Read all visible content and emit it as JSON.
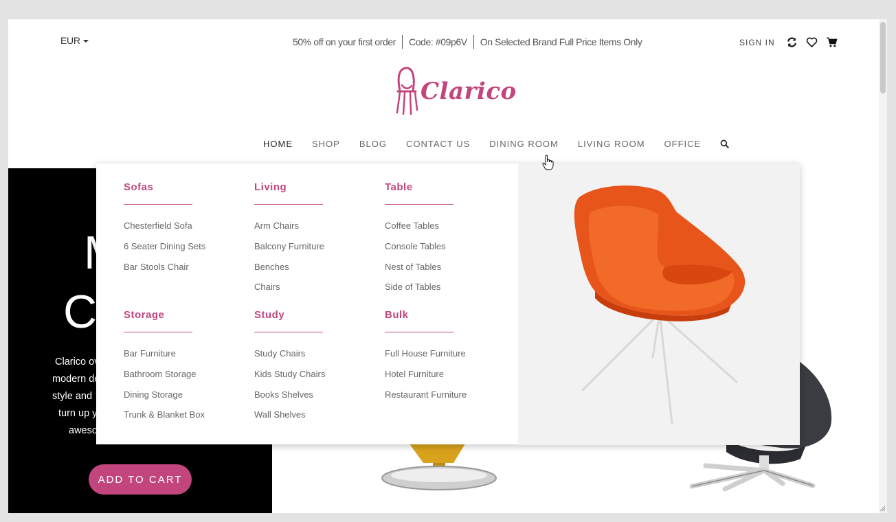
{
  "header": {
    "currency": "EUR",
    "promo": [
      "50% off on your first order",
      "Code: #09p6V",
      "On Selected Brand Full Price Items Only"
    ],
    "signin": "SIGN IN"
  },
  "logo": {
    "text": "Clarico"
  },
  "nav": {
    "items": [
      "HOME",
      "SHOP",
      "BLOG",
      "CONTACT US",
      "DINING ROOM",
      "LIVING ROOM",
      "OFFICE"
    ],
    "active": "HOME",
    "hovered": "LIVING ROOM"
  },
  "hero": {
    "heading_line1": "M",
    "heading_line2": "Co",
    "desc_lines": [
      "Clarico ov",
      "modern de",
      "style and",
      "turn up y",
      "aweso"
    ],
    "cta": "ADD TO CART"
  },
  "mega_menu": {
    "columns": [
      {
        "title": "Sofas",
        "items": [
          "Chesterfield Sofa",
          "6 Seater Dining Sets",
          "Bar Stools Chair"
        ]
      },
      {
        "title": "Living",
        "items": [
          "Arm Chairs",
          "Balcony Furniture",
          "Benches",
          "Chairs"
        ]
      },
      {
        "title": "Table",
        "items": [
          "Coffee Tables",
          "Console Tables",
          "Nest of Tables",
          "Side of Tables"
        ]
      },
      {
        "title": "Storage",
        "items": [
          "Bar Furniture",
          "Bathroom Storage",
          "Dining Storage",
          "Trunk & Blanket Box"
        ]
      },
      {
        "title": "Study",
        "items": [
          "Study Chairs",
          "Kids Study Chairs",
          "Books Shelves",
          "Wall Shelves"
        ]
      },
      {
        "title": "Bulk",
        "items": [
          "Full House Furniture",
          "Hotel Furniture",
          "Restaurant Furniture"
        ]
      }
    ]
  },
  "colors": {
    "accent": "#c2457d",
    "chair_orange": "#e8551b"
  },
  "icons": [
    "refresh-icon",
    "heart-icon",
    "cart-icon",
    "search-icon",
    "hand-cursor-icon"
  ]
}
